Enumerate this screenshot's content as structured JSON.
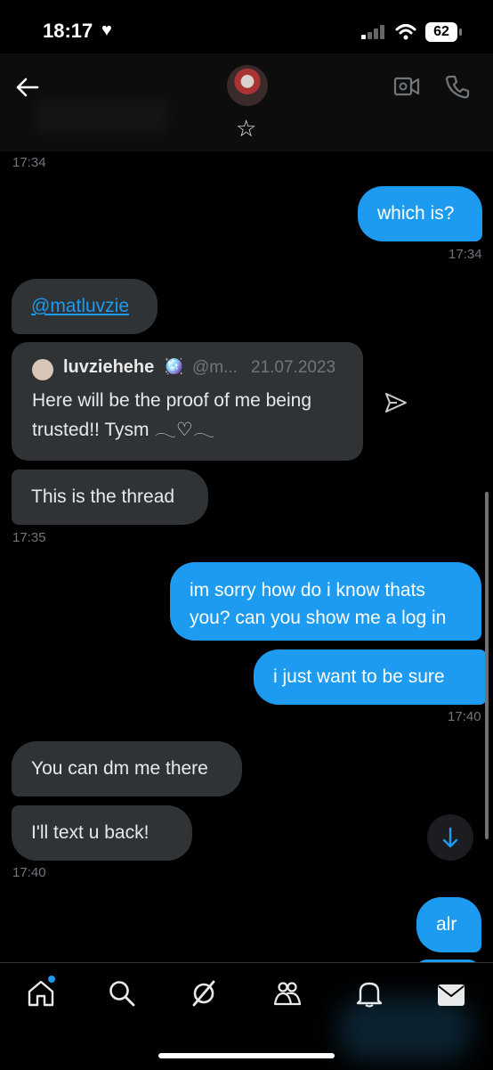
{
  "status_bar": {
    "time": "18:17",
    "battery": "62"
  },
  "header": {
    "star": "☆"
  },
  "messages": [
    {
      "type": "timestamp",
      "text": "17:34"
    },
    {
      "type": "outgoing",
      "text": "which is?"
    },
    {
      "type": "timestamp",
      "text": "17:34"
    },
    {
      "type": "incoming",
      "text": "@matluvzie"
    },
    {
      "type": "quote",
      "name": "luvziehehe",
      "emoji": "🪩",
      "handle": "@m...",
      "date": "21.07.2023",
      "text": "Here will be the proof of me being trusted!! Tysm 𓂃♡𓂃"
    },
    {
      "type": "incoming",
      "text": "This is the thread"
    },
    {
      "type": "timestamp",
      "text": "17:35"
    },
    {
      "type": "outgoing",
      "text": "im sorry how do i know thats you? can you show me a log in"
    },
    {
      "type": "outgoing",
      "text": "i just want to be sure"
    },
    {
      "type": "timestamp",
      "text": "17:40"
    },
    {
      "type": "incoming",
      "text": "You can dm me there"
    },
    {
      "type": "incoming",
      "text": "I'll text u back!"
    },
    {
      "type": "timestamp",
      "text": "17:40"
    },
    {
      "type": "outgoing",
      "text": "alr"
    }
  ],
  "colors": {
    "accent": "#1d9bf0",
    "incoming_bubble": "#2f3336",
    "background": "#000000"
  },
  "tabs": [
    {
      "icon": "home-icon"
    },
    {
      "icon": "search-icon"
    },
    {
      "icon": "grok-icon"
    },
    {
      "icon": "communities-icon"
    },
    {
      "icon": "notifications-icon"
    },
    {
      "icon": "messages-icon"
    }
  ]
}
